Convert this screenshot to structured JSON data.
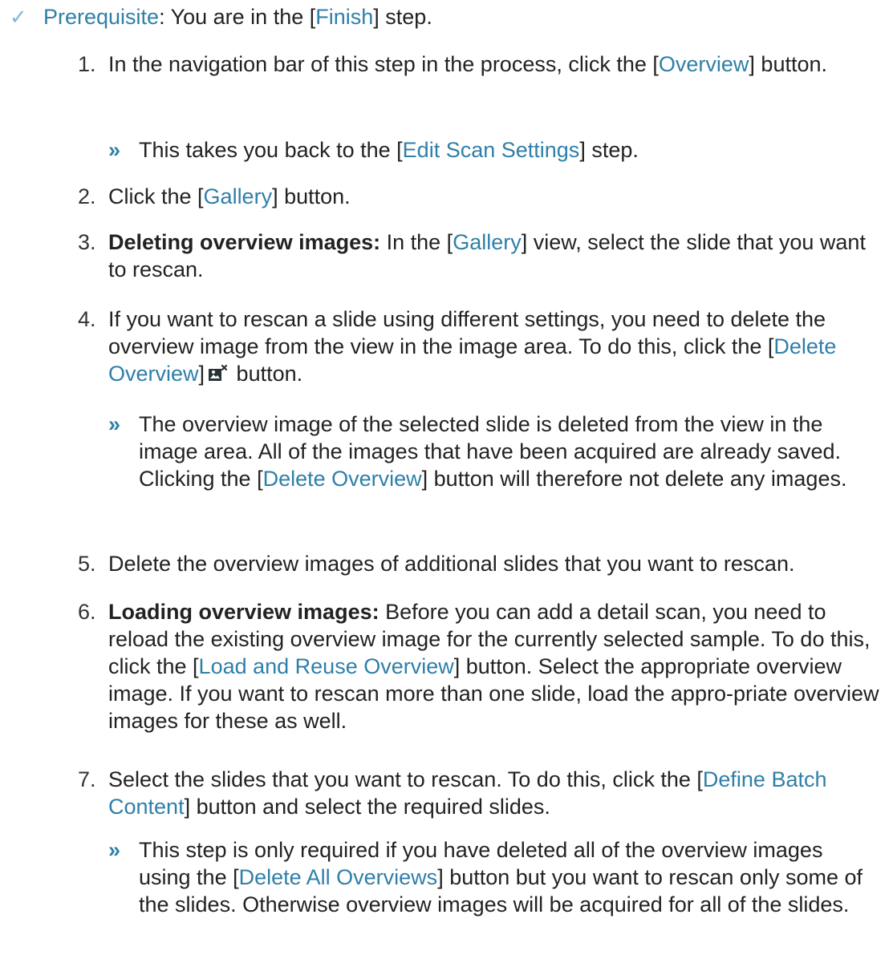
{
  "prerequisite": {
    "label": "Prerequisite",
    "text_before": ": You are in the [",
    "finish_link": "Finish",
    "text_after": "] step."
  },
  "steps": [
    {
      "number": "1.",
      "parts": [
        "In the navigation bar of this step in the process, click the [",
        "Overview",
        "] button."
      ]
    },
    {
      "number": "2.",
      "parts": [
        "Click the [",
        "Gallery",
        "] button."
      ]
    },
    {
      "number": "3.",
      "bold": "Deleting overview images:",
      "parts": [
        " In the [",
        "Gallery",
        "] view, select the slide that you want to rescan."
      ]
    },
    {
      "number": "4.",
      "parts": [
        "If you want to rescan a slide using different settings, you need to delete the overview image from the view in the image area. To do this, click the [",
        "Delete Overview",
        "]",
        " button."
      ]
    },
    {
      "number": "5.",
      "text": "Delete the overview images of additional slides that you want to rescan."
    },
    {
      "number": "6.",
      "bold": "Loading overview images:",
      "parts": [
        " Before you can add a detail scan, you need to reload the existing overview image for the currently selected sample. To do this, click the [",
        "Load and Reuse Overview",
        "] button. Select the appropriate overview image. If you want to rescan more than one slide, load the appro-priate overview images for these as well."
      ]
    },
    {
      "number": "7.",
      "parts": [
        "Select the slides that you want to rescan. To do this, click the [",
        "Define Batch Content",
        "] button and select the required slides."
      ]
    }
  ],
  "results": [
    {
      "marker": "»",
      "parts": [
        "This takes you back to the [",
        "Edit Scan Settings",
        "] step."
      ]
    },
    {
      "marker": "»",
      "parts": [
        "The overview image of the selected slide is deleted from the view in the image area. All of the images that have been acquired are already saved. Clicking the [",
        "Delete Overview",
        "] button will therefore not delete any images."
      ]
    },
    {
      "marker": "»",
      "parts": [
        "This step is only required if you have deleted all of the overview images using the [",
        "Delete All Overviews",
        "] button but you want to rescan only some of the slides. Otherwise overview images will be acquired for all of the slides."
      ]
    }
  ],
  "icons": {
    "prerequisite": "checkmark-icon",
    "delete_overview": "delete-overview-icon",
    "result": "result-arrow-icon"
  },
  "colors": {
    "link": "#2f7fa8",
    "check": "#7fb7dc",
    "text": "#222222"
  }
}
